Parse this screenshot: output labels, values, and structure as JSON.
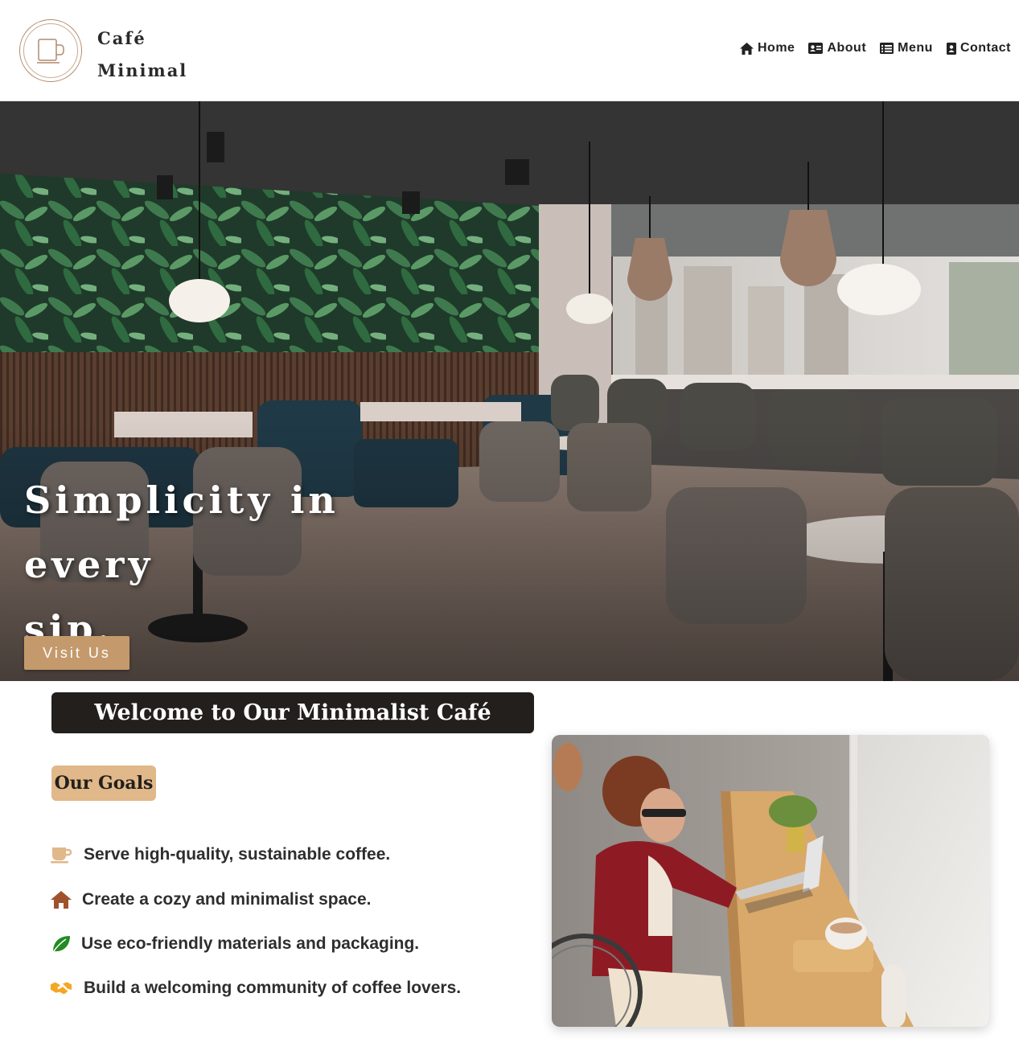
{
  "brand": {
    "line1": "Café",
    "line2": "Minimal",
    "logo_icon": "coffee-cup-icon"
  },
  "nav": {
    "home": {
      "label": "Home",
      "icon": "home-icon"
    },
    "about": {
      "label": "About",
      "icon": "id-card-icon"
    },
    "menu": {
      "label": "Menu",
      "icon": "list-icon"
    },
    "contact": {
      "label": "Contact",
      "icon": "contact-book-icon"
    }
  },
  "hero": {
    "title_line1": "Simplicity in every",
    "title_line2": "sip.",
    "cta_label": "Visit Us"
  },
  "main": {
    "welcome_title": "Welcome to Our Minimalist Café",
    "goals_title": "Our Goals",
    "goals": [
      {
        "text": "Serve high-quality, sustainable coffee.",
        "icon": "coffee-cup-icon"
      },
      {
        "text": "Create a cozy and minimalist space.",
        "icon": "house-icon"
      },
      {
        "text": "Use eco-friendly materials and packaging.",
        "icon": "leaf-icon"
      },
      {
        "text": "Build a welcoming community of coffee lovers.",
        "icon": "handshake-icon"
      }
    ]
  },
  "colors": {
    "accent": "#c49a6c",
    "badge": "#e0b889",
    "dark": "#231f1d",
    "house": "#a0522d",
    "leaf": "#228b22",
    "handshake": "#f5a623"
  }
}
